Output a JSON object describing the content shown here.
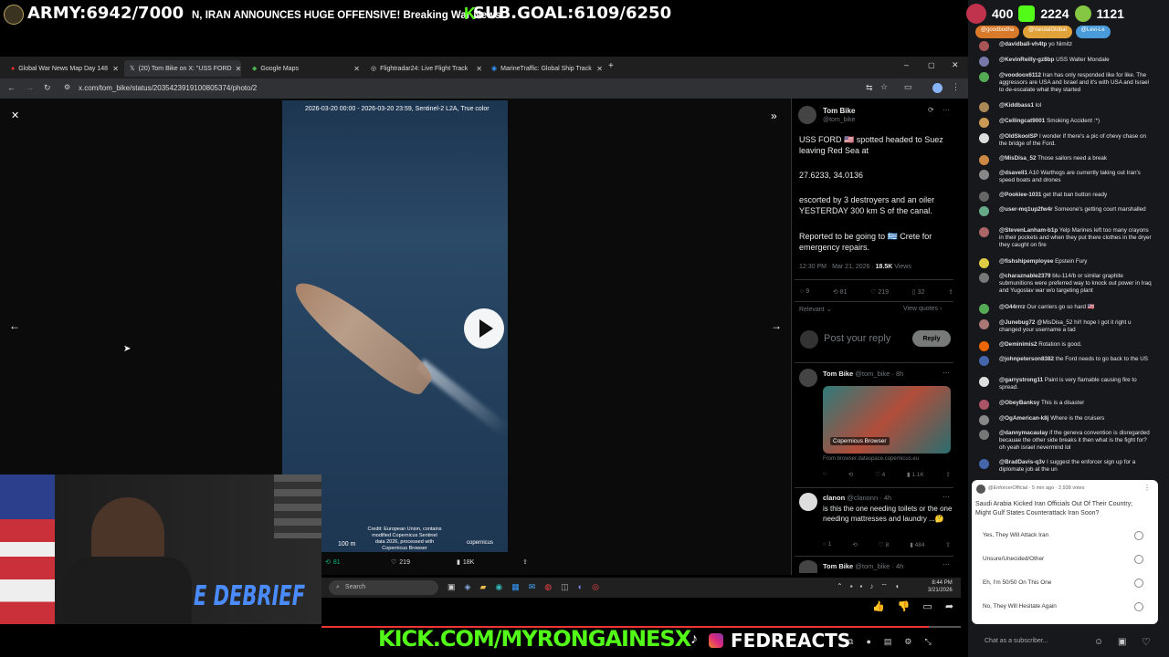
{
  "overlay": {
    "army": "ARMY:6942/7000",
    "ticker": "N, IRAN ANNOUNCES HUGE OFFENSIVE! Breaking War News",
    "subgoal": "SUB.GOAL:6109/6250",
    "stats": {
      "viewers": "400",
      "kick": "2224",
      "rumble": "1121"
    },
    "chips": [
      "@goodbodha",
      "@VandalGlobal",
      "@Levi-Le"
    ]
  },
  "browser": {
    "tabs": [
      {
        "label": "Global War News Map Day 148"
      },
      {
        "label": "(20) Tom Bike on X: \"USS FORD"
      },
      {
        "label": "Google Maps"
      },
      {
        "label": "Flightradar24: Live Flight Track"
      },
      {
        "label": "MarineTraffic: Global Ship Track"
      }
    ],
    "url": "x.com/tom_bike/status/2035423919100805374/photo/2"
  },
  "media": {
    "caption": "2026-03-20 00:00 - 2026-03-20 23:59, Sentinel-2 L2A, True color",
    "credit": "Credit: European Union, contains modified Copernicus Sentinel data 2026, processed with Copernicus Browser",
    "scale": "100 m",
    "brand": "copernicus",
    "actions": {
      "retweets": "81",
      "likes": "219",
      "views": "18K"
    }
  },
  "tweet": {
    "name": "Tom Bike",
    "handle": "@tom_bike",
    "p1": "USS FORD 🇺🇸 spotted headed to Suez leaving Red Sea at",
    "coords": "27.6233, 34.0136",
    "p2": "escorted by 3 destroyers and an oiler YESTERDAY 300 km S of the canal.",
    "p3": "Reported to be going to 🇬🇷 Crete for emergency repairs.",
    "meta_time": "12:30 PM · Mar 21, 2026 · ",
    "meta_views": "18.5K",
    "meta_views_label": " Views",
    "stats": {
      "replies": "9",
      "retweets": "81",
      "likes": "219",
      "bookmarks": "32"
    },
    "relevant": "Relevant ⌄",
    "view_quotes": "View quotes ›",
    "post_reply": "Post your reply",
    "reply_btn": "Reply",
    "reply1": {
      "name": "Tom Bike",
      "handle": "@tom_bike · 8h",
      "img_label": "Copernicus Browser",
      "link": "From browser.dataspace.copernicus.eu",
      "stats": {
        "likes": "4",
        "views": "1.1K"
      }
    },
    "reply2": {
      "name": "clanon",
      "handle": "@clanonn · 4h",
      "text": "is this the one needing toilets or the one needing mattresses and laundry ...🤔",
      "stats": {
        "replies": "1",
        "likes": "8",
        "views": "484"
      }
    },
    "reply3": {
      "name": "Tom Bike",
      "handle": "@tom_bike · 4h"
    }
  },
  "chat": [
    {
      "user": "@davidball-vh4tp",
      "msg": "yo Nimitz",
      "color": "#a55"
    },
    {
      "user": "@KevinReilly-gz8bp",
      "msg": "USS Walter Mondale",
      "color": "#77a"
    },
    {
      "user": "@voodoox6112",
      "msg": "Iran has only responded like for like. The aggressors are USA and Israel and it's with USA and Israel to de-escalate what they started",
      "color": "#5a5"
    },
    {
      "user": "@Kiddbass1",
      "msg": "lol",
      "color": "#a85"
    },
    {
      "user": "@Cellingcat9001",
      "msg": "Smoking Accident :*)",
      "color": "#c95"
    },
    {
      "user": "@OldSkoolSP",
      "msg": "I wonder if there's a pic of chevy chase on the bridge of the Ford.",
      "color": "#ddd"
    },
    {
      "user": "@MisDisa_52",
      "msg": "Those sailors need a break",
      "color": "#c84"
    },
    {
      "user": "@dsavell1",
      "msg": "A10 Warthogs are currently taking out Iran's speed boats and drones",
      "color": "#888"
    },
    {
      "user": "@Pookiee-1031",
      "msg": "get that ban button ready",
      "color": "#666"
    },
    {
      "user": "@user-mq1up2fw4r",
      "msg": "Someone's getting court marshalled",
      "color": "#6a8"
    },
    {
      "user": "@StevenLanham-b1p",
      "msg": "Yelp Marines left too many crayons in their pockets and when they put there clothes in the dryer they caught on fire",
      "color": "#a66"
    },
    {
      "user": "@fishshipemployee",
      "msg": "Epstein Fury",
      "color": "#dc4"
    },
    {
      "user": "@charaznable2379",
      "msg": "blu-114/b or similar graphite submunitions were preferred way to knock out power in Iraq and Yugoslav war w/o targeting plant",
      "color": "#777"
    },
    {
      "user": "@O44rrrz",
      "msg": "Our carriers go so hard 🇺🇸",
      "color": "#5a5"
    },
    {
      "user": "@Junebug72",
      "msg": "@MisDisa_52 hi!! hope I got it right u changed your username a tad",
      "color": "#a77"
    },
    {
      "user": "@Deminimis2",
      "msg": "Rotation is good.",
      "color": "#e60"
    },
    {
      "user": "@johnpeterson8382",
      "msg": "the Ford needs to go back to the US",
      "color": "#46a"
    },
    {
      "user": "@garrystrong11",
      "msg": "Paint is very flamable causing fire to spread.",
      "color": "#ddd"
    },
    {
      "user": "@ObeyBanksy",
      "msg": "This is a disaster",
      "color": "#a56"
    },
    {
      "user": "@OgAmerican-k8j",
      "msg": "Where is the cruisers",
      "color": "#888"
    },
    {
      "user": "@dannymacaulay",
      "msg": "if the geneva convention is disregarded becauae the other side breaks it then what is the fight for? oh yeah israel nevermind lol",
      "color": "#777"
    },
    {
      "user": "@BradDavis-q3v",
      "msg": "I suggest the enforcer sign up for a diplomate job at the un",
      "color": "#46a"
    }
  ],
  "poll": {
    "author": "@EnforcerOfficial",
    "meta": " · 5 min ago · 2,938 votes",
    "question": "Saudi Arabia Kicked Iran Officials Out Of Their Country; Might Gulf States Counterattack Iran Soon?",
    "options": [
      "Yes, They Will Attack Iran",
      "Unsure/Unecided/Other",
      "Eh, I'm 50/50 On This One",
      "No, They Will Hesitate Again"
    ]
  },
  "chat_input": {
    "placeholder": "Chat as a subscriber..."
  },
  "taskbar": {
    "search": "Search",
    "time": "8:44 PM",
    "date": "3/21/2026"
  },
  "bottom": {
    "kick": "KICK.COM/MYRONGAINESX",
    "fed": "FEDREACTS"
  },
  "webcam": {
    "banner": "E DEBRIEF"
  }
}
